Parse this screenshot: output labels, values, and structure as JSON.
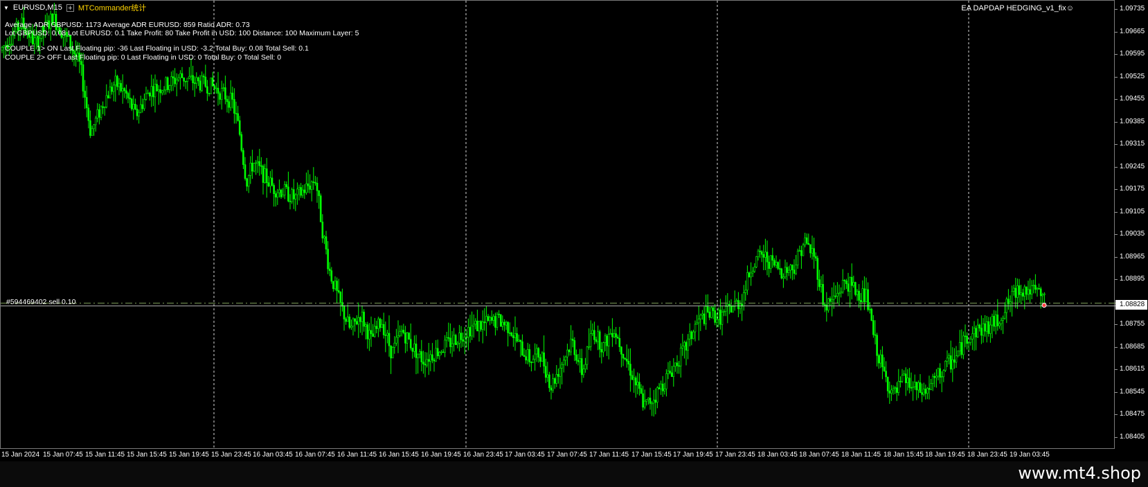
{
  "symbol": "EURUSD,M15",
  "indicator_name": "MTCommander统计",
  "ea_label": "EA DAPDAP HEDGING_v1_fix☺",
  "info_lines": [
    "Average ADR GBPUSD: 1173   Average ADR EURUSD: 859   Ratio ADR: 0.73",
    "Lot GBPUSD: 0.08   Lot EURUSD: 0.1   Take Profit: 80   Take Profit in USD: 100   Distance: 100   Maximum Layer: 5",
    "COUPLE 1>    ON   Last Floating pip: -36   Last Floating in USD: -3.2   Total Buy: 0.08   Total Sell: 0.1",
    "COUPLE 2>    OFF   Last Floating pip: 0   Last Floating in USD: 0   Total Buy: 0   Total Sell: 0"
  ],
  "order_label": "#594469402 sell 0.10",
  "current_price": "1.08828",
  "price_labels": [
    "1.09735",
    "1.09665",
    "1.09595",
    "1.09525",
    "1.09455",
    "1.09385",
    "1.09315",
    "1.09245",
    "1.09175",
    "1.09105",
    "1.09035",
    "1.08965",
    "1.08895",
    "1.08755",
    "1.08685",
    "1.08615",
    "1.08545",
    "1.08475",
    "1.08405"
  ],
  "time_labels": [
    "15 Jan 2024",
    "15 Jan 07:45",
    "15 Jan 11:45",
    "15 Jan 15:45",
    "15 Jan 19:45",
    "15 Jan 23:45",
    "16 Jan 03:45",
    "16 Jan 07:45",
    "16 Jan 11:45",
    "16 Jan 15:45",
    "16 Jan 19:45",
    "16 Jan 23:45",
    "17 Jan 03:45",
    "17 Jan 07:45",
    "17 Jan 11:45",
    "17 Jan 15:45",
    "17 Jan 19:45",
    "17 Jan 23:45",
    "18 Jan 03:45",
    "18 Jan 07:45",
    "18 Jan 11:45",
    "18 Jan 15:45",
    "18 Jan 19:45",
    "18 Jan 23:45",
    "19 Jan 03:45"
  ],
  "watermark": "www.mt4.shop",
  "colors": {
    "background": "#000000",
    "candle": "#00ff00",
    "order_line": "#7fa05a",
    "grid": "#ffffff",
    "indicator": "#ffd400"
  },
  "chart_data": {
    "type": "candlestick",
    "ylim": [
      1.08405,
      1.09735
    ],
    "period_separators_at": [
      "16 Jan 00:00",
      "17 Jan 00:00",
      "18 Jan 00:00",
      "19 Jan 00:00"
    ],
    "order_line_price": 1.08828,
    "close_path": [
      [
        0,
        1.096
      ],
      [
        30,
        1.0968
      ],
      [
        50,
        1.0962
      ],
      [
        75,
        1.097
      ],
      [
        100,
        1.0962
      ],
      [
        115,
        1.0955
      ],
      [
        130,
        1.0935
      ],
      [
        150,
        1.0945
      ],
      [
        165,
        1.095
      ],
      [
        180,
        1.0947
      ],
      [
        195,
        1.094
      ],
      [
        215,
        1.0948
      ],
      [
        235,
        1.0949
      ],
      [
        260,
        1.0952
      ],
      [
        285,
        1.095
      ],
      [
        305,
        1.0949
      ],
      [
        320,
        1.0947
      ],
      [
        335,
        1.0944
      ],
      [
        345,
        1.0935
      ],
      [
        355,
        1.092
      ],
      [
        365,
        1.0926
      ],
      [
        380,
        1.0922
      ],
      [
        395,
        1.0918
      ],
      [
        410,
        1.0917
      ],
      [
        425,
        1.0915
      ],
      [
        440,
        1.0918
      ],
      [
        455,
        1.0921
      ],
      [
        465,
        1.0905
      ],
      [
        475,
        1.0893
      ],
      [
        490,
        1.0883
      ],
      [
        505,
        1.0875
      ],
      [
        520,
        1.088
      ],
      [
        535,
        1.0872
      ],
      [
        550,
        1.0878
      ],
      [
        565,
        1.0868
      ],
      [
        580,
        1.0875
      ],
      [
        595,
        1.087
      ],
      [
        610,
        1.0866
      ],
      [
        625,
        1.0868
      ],
      [
        640,
        1.087
      ],
      [
        660,
        1.0873
      ],
      [
        680,
        1.0876
      ],
      [
        700,
        1.0877
      ],
      [
        720,
        1.0878
      ],
      [
        735,
        1.0876
      ],
      [
        750,
        1.087
      ],
      [
        765,
        1.0866
      ],
      [
        780,
        1.0868
      ],
      [
        795,
        1.0858
      ],
      [
        810,
        1.0865
      ],
      [
        825,
        1.0872
      ],
      [
        840,
        1.0862
      ],
      [
        855,
        1.0875
      ],
      [
        870,
        1.087
      ],
      [
        885,
        1.0876
      ],
      [
        900,
        1.0868
      ],
      [
        915,
        1.086
      ],
      [
        930,
        1.0852
      ],
      [
        945,
        1.0855
      ],
      [
        960,
        1.086
      ],
      [
        975,
        1.0865
      ],
      [
        990,
        1.087
      ],
      [
        1005,
        1.0877
      ],
      [
        1020,
        1.088
      ],
      [
        1040,
        1.0879
      ],
      [
        1055,
        1.0882
      ],
      [
        1070,
        1.0884
      ],
      [
        1085,
        1.0895
      ],
      [
        1100,
        1.0898
      ],
      [
        1115,
        1.0895
      ],
      [
        1130,
        1.0893
      ],
      [
        1145,
        1.0894
      ],
      [
        1160,
        1.0902
      ],
      [
        1175,
        1.0898
      ],
      [
        1190,
        1.0882
      ],
      [
        1205,
        1.0885
      ],
      [
        1220,
        1.089
      ],
      [
        1235,
        1.0887
      ],
      [
        1250,
        1.0885
      ],
      [
        1262,
        1.0872
      ],
      [
        1275,
        1.0862
      ],
      [
        1290,
        1.0855
      ],
      [
        1305,
        1.086
      ],
      [
        1320,
        1.0857
      ],
      [
        1335,
        1.0856
      ],
      [
        1350,
        1.086
      ],
      [
        1365,
        1.0864
      ],
      [
        1380,
        1.0867
      ],
      [
        1395,
        1.0873
      ],
      [
        1410,
        1.0875
      ],
      [
        1425,
        1.0876
      ],
      [
        1440,
        1.0878
      ],
      [
        1455,
        1.0883
      ],
      [
        1470,
        1.0888
      ],
      [
        1485,
        1.0887
      ],
      [
        1500,
        1.0886
      ],
      [
        1508,
        1.0884
      ]
    ]
  }
}
